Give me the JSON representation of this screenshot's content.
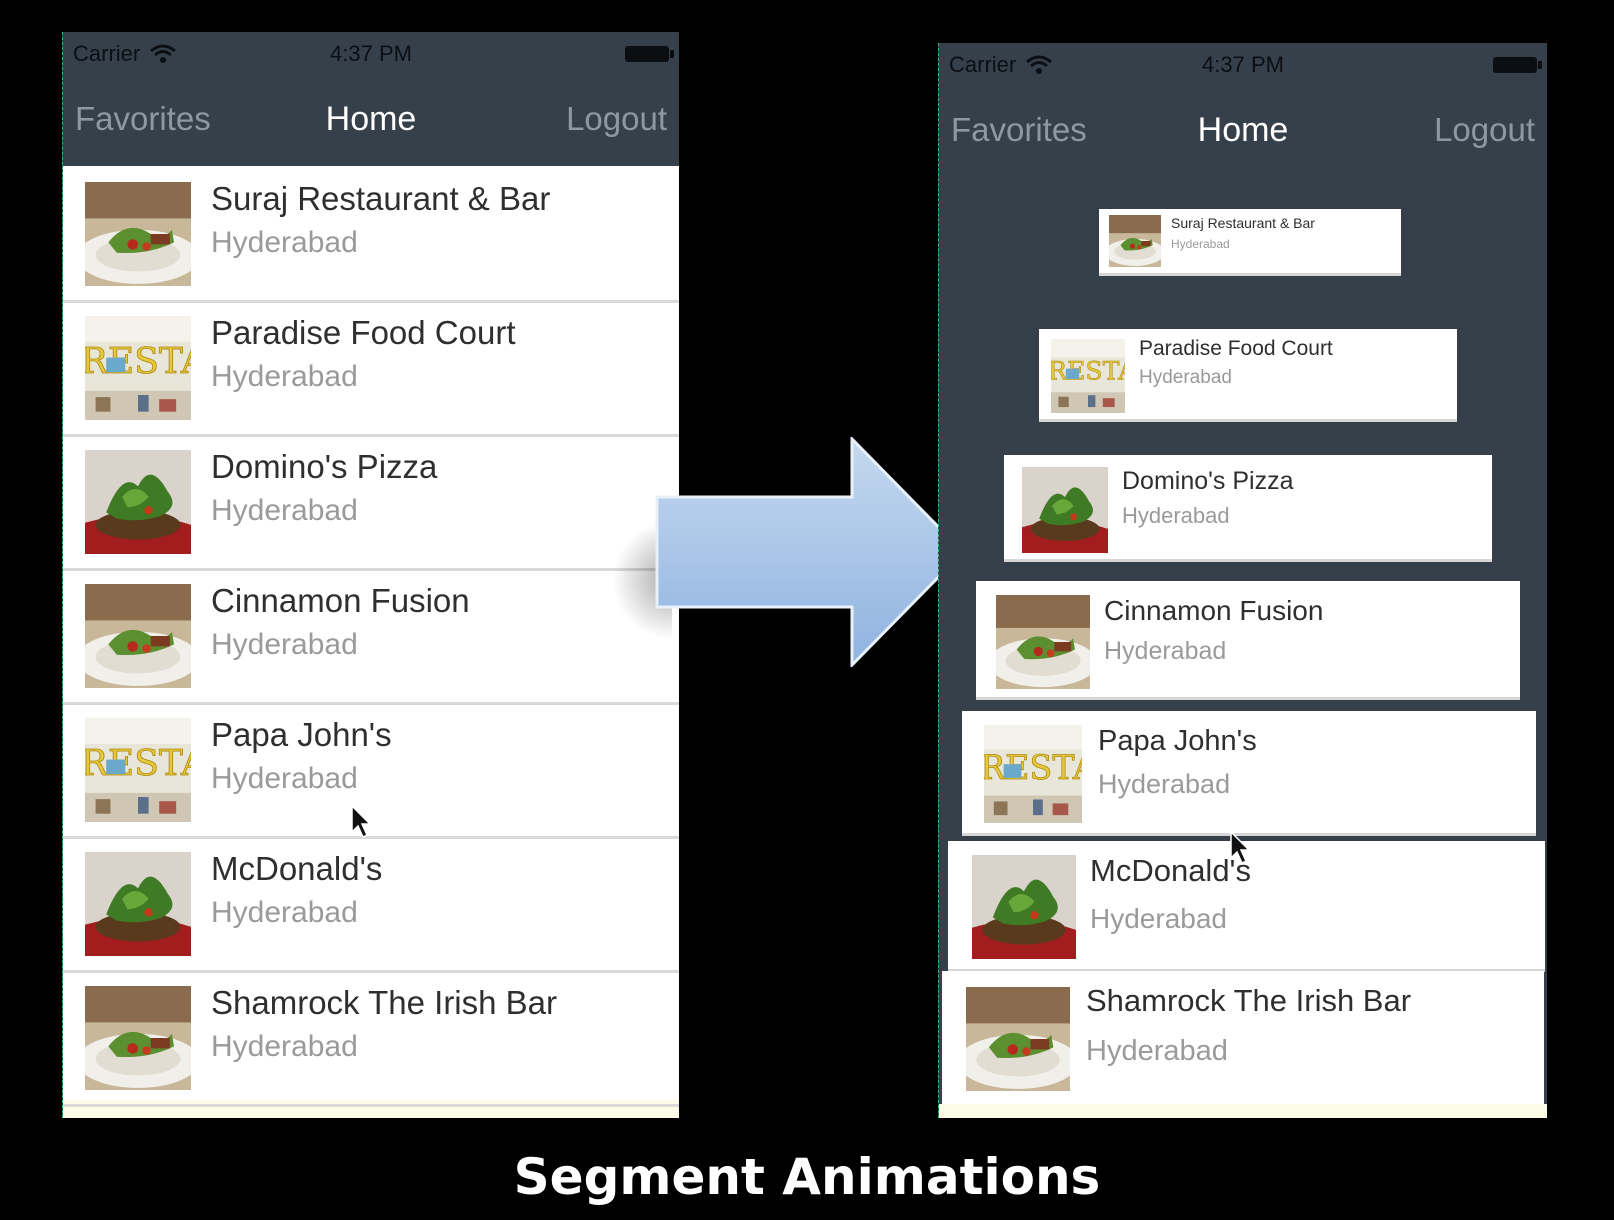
{
  "status_bar": {
    "carrier": "Carrier",
    "time": "4:37 PM"
  },
  "nav_bar": {
    "left": "Favorites",
    "title": "Home",
    "right": "Logout"
  },
  "restaurants": [
    {
      "name": "Suraj Restaurant & Bar",
      "city": "Hyderabad",
      "image": "salad-plate"
    },
    {
      "name": "Paradise Food Court",
      "city": "Hyderabad",
      "image": "resta-sign"
    },
    {
      "name": "Domino's Pizza",
      "city": "Hyderabad",
      "image": "greens-dish"
    },
    {
      "name": "Cinnamon Fusion",
      "city": "Hyderabad",
      "image": "salad-plate"
    },
    {
      "name": "Papa John's",
      "city": "Hyderabad",
      "image": "resta-sign"
    },
    {
      "name": "McDonald's",
      "city": "Hyderabad",
      "image": "greens-dish"
    },
    {
      "name": "Shamrock The Irish Bar",
      "city": "Hyderabad",
      "image": "salad-plate"
    }
  ],
  "caption": "Segment Animations",
  "colors": {
    "nav": "#36404b",
    "arrow": "#a9c6e8",
    "background": "#000000"
  }
}
